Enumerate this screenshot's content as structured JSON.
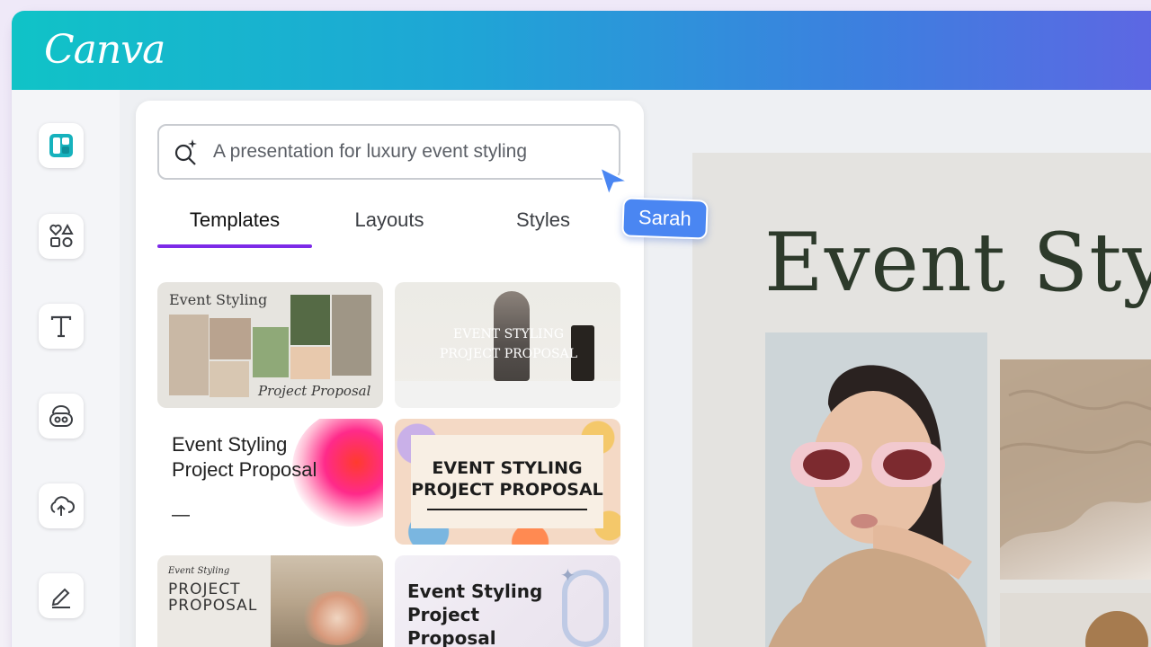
{
  "app": {
    "logo": "Canva"
  },
  "sidebar": {
    "items": [
      {
        "icon": "design-icon"
      },
      {
        "icon": "elements-icon"
      },
      {
        "icon": "text-icon"
      },
      {
        "icon": "brand-icon"
      },
      {
        "icon": "uploads-icon"
      },
      {
        "icon": "draw-icon"
      }
    ]
  },
  "search": {
    "placeholder": "A presentation for luxury event styling"
  },
  "tabs": [
    {
      "label": "Templates",
      "active": true
    },
    {
      "label": "Layouts",
      "active": false
    },
    {
      "label": "Styles",
      "active": false
    }
  ],
  "templates": [
    {
      "line1": "Event Styling",
      "line2": "Project Proposal"
    },
    {
      "line1": "EVENT STYLING",
      "line2": "PROJECT PROPOSAL"
    },
    {
      "line1": "Event Styling",
      "line2": "Project Proposal",
      "line3": "—"
    },
    {
      "line1": "EVENT STYLING",
      "line2": "PROJECT PROPOSAL"
    },
    {
      "line1": "Event Styling",
      "line2": "PROJECT",
      "line3": "PROPOSAL"
    },
    {
      "line1": "Event Styling",
      "line2": "Project",
      "line3": "Proposal"
    }
  ],
  "collaborator": {
    "name": "Sarah",
    "color": "#4a86f2"
  },
  "canvas": {
    "headline": "Event Sty"
  },
  "colors": {
    "accent": "#7d2ae8",
    "brand_start": "#10c3c7",
    "brand_end": "#5d67e3"
  }
}
